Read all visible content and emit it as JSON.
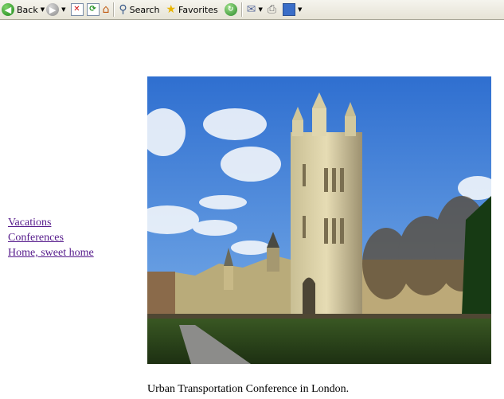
{
  "toolbar": {
    "back_label": "Back",
    "search_label": "Search",
    "favorites_label": "Favorites"
  },
  "nav_links": [
    {
      "label": "Vacations"
    },
    {
      "label": "Conferences"
    },
    {
      "label": "Home, sweet home"
    }
  ],
  "photo": {
    "subject": "palace-tower-photo"
  },
  "caption": "Urban Transportation Conference in London."
}
